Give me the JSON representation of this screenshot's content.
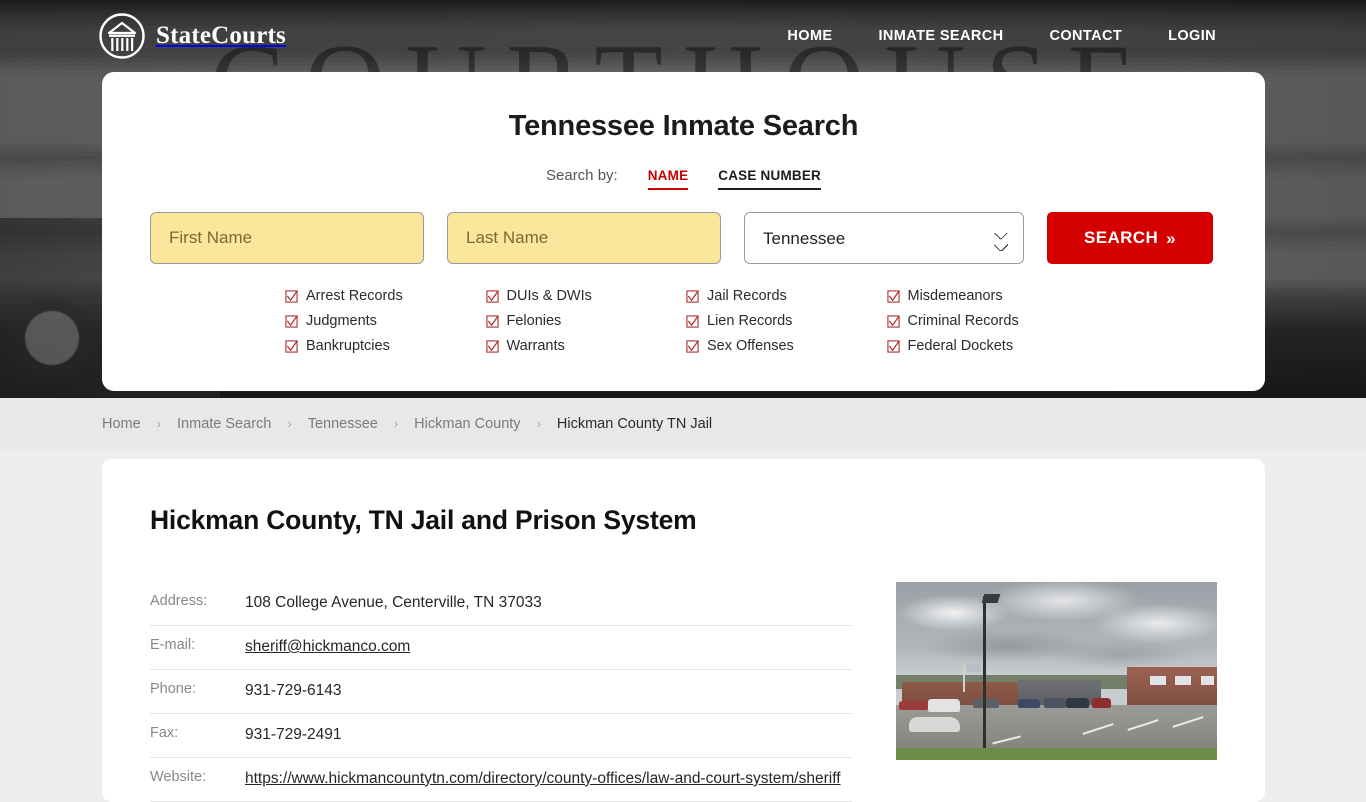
{
  "header": {
    "brand_name": "StateCourts",
    "brand_icon": "courthouse-circle-logo",
    "nav": [
      {
        "label": "HOME"
      },
      {
        "label": "INMATE SEARCH"
      },
      {
        "label": "CONTACT"
      },
      {
        "label": "LOGIN"
      }
    ],
    "background_watermark": "COURTHOUSE"
  },
  "search": {
    "title": "Tennessee Inmate Search",
    "search_by_label": "Search by:",
    "tabs": [
      {
        "label": "NAME",
        "active": true
      },
      {
        "label": "CASE NUMBER",
        "active": false
      }
    ],
    "first_name_placeholder": "First Name",
    "first_name_value": "",
    "last_name_placeholder": "Last Name",
    "last_name_value": "",
    "state_selected": "Tennessee",
    "state_options": [
      "Tennessee"
    ],
    "submit_label": "SEARCH",
    "submit_chevron": "»",
    "record_types": [
      "Arrest Records",
      "DUIs & DWIs",
      "Jail Records",
      "Misdemeanors",
      "Judgments",
      "Felonies",
      "Lien Records",
      "Criminal Records",
      "Bankruptcies",
      "Warrants",
      "Sex Offenses",
      "Federal Dockets"
    ]
  },
  "breadcrumb": {
    "separator": "›",
    "items": [
      {
        "label": "Home",
        "current": false
      },
      {
        "label": "Inmate Search",
        "current": false
      },
      {
        "label": "Tennessee",
        "current": false
      },
      {
        "label": "Hickman County",
        "current": false
      },
      {
        "label": "Hickman County TN Jail",
        "current": true
      }
    ]
  },
  "main": {
    "page_title": "Hickman County, TN Jail and Prison System",
    "info_rows": [
      {
        "label": "Address:",
        "value": "108 College Avenue, Centerville, TN 37033",
        "link": false
      },
      {
        "label": "E-mail:",
        "value": "sheriff@hickmanco.com",
        "link": true
      },
      {
        "label": "Phone:",
        "value": "931-729-6143",
        "link": false
      },
      {
        "label": "Fax:",
        "value": "931-729-2491",
        "link": false
      },
      {
        "label": "Website:",
        "value": "https://www.hickmancountytn.com/directory/county-offices/law-and-court-system/sheriff",
        "link": true
      }
    ],
    "photo_alt": "hickman-county-jail-building-photo"
  },
  "colors": {
    "accent_red": "#cc0000",
    "button_red": "#d40000",
    "field_yellow": "#fbe69b",
    "page_bg": "#eeeeee",
    "breadcrumb_bg": "#e8e8e8"
  }
}
